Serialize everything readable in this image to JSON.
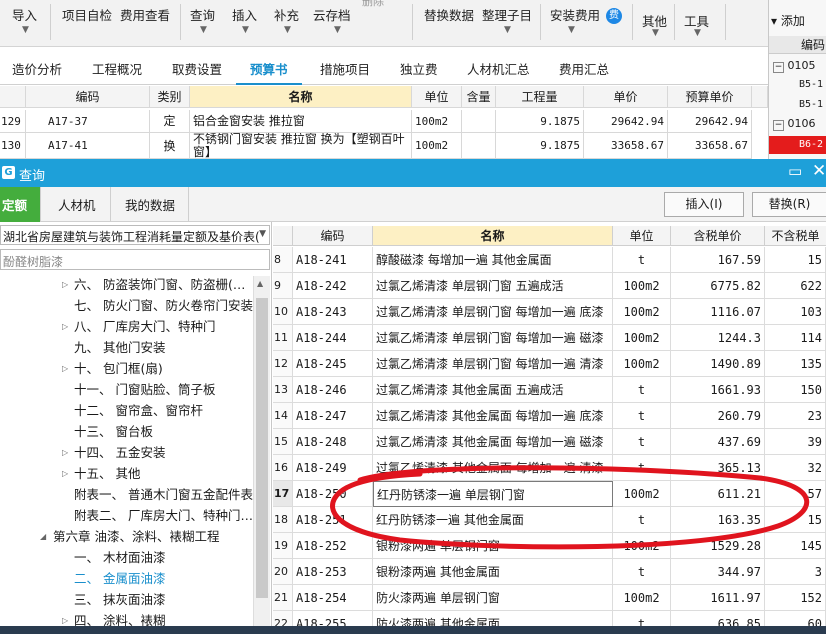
{
  "ribbon": {
    "import": "导入",
    "project_check": "项目自检",
    "fee_view": "费用查看",
    "query": "查询",
    "insert": "插入",
    "supplement": "补充",
    "cloud_save": "云存档",
    "delete": "删除",
    "replace_data": "替换数据",
    "organize_sub": "整理子目",
    "install_fee": "安装费用",
    "fee_badge": "费",
    "other": "其他",
    "tools": "工具"
  },
  "right_panel": {
    "add": "添加",
    "code_header": "编码",
    "rows": [
      "0105",
      "B5-1",
      "B5-1",
      "0106",
      "B6-2"
    ]
  },
  "tabs": [
    "造价分析",
    "工程概况",
    "取费设置",
    "预算书",
    "措施项目",
    "独立费",
    "人材机汇总",
    "费用汇总"
  ],
  "active_tab": "预算书",
  "top_grid": {
    "headers": [
      "编码",
      "类别",
      "名称",
      "单位",
      "含量",
      "工程量",
      "单价",
      "预算单价"
    ],
    "rows": [
      {
        "no": "129",
        "code": "A17-37",
        "type": "定",
        "name": "铝合金窗安装 推拉窗",
        "unit": "100m2",
        "qty": "9.1875",
        "price": "29642.94",
        "budget": "29642.94"
      },
      {
        "no": "130",
        "code": "A17-41",
        "type": "换",
        "name": "不锈钢门窗安装 推拉窗  换为【塑钢百叶窗】",
        "unit": "100m2",
        "qty": "9.1875",
        "price": "33658.67",
        "budget": "33658.67"
      }
    ]
  },
  "dialog": {
    "title": "查询",
    "tabs": [
      "定额",
      "人材机",
      "我的数据"
    ],
    "insert_btn": "插入(I)",
    "replace_btn": "替换(R)",
    "library": "湖北省房屋建筑与装饰工程消耗量定额及基价表(",
    "search_placeholder": "酚醛树脂漆"
  },
  "tree": [
    {
      "label": "六、 防盗装饰门窗、防盗栅(…",
      "arrow": "▷"
    },
    {
      "label": "七、 防火门窗、防火卷帘门安装",
      "arrow": ""
    },
    {
      "label": "八、 厂库房大门、特种门",
      "arrow": "▷"
    },
    {
      "label": "九、 其他门安装",
      "arrow": ""
    },
    {
      "label": "十、 包门框(扇)",
      "arrow": "▷"
    },
    {
      "label": "十一、 门窗贴脸、筒子板",
      "arrow": ""
    },
    {
      "label": "十二、 窗帘盒、窗帘杆",
      "arrow": ""
    },
    {
      "label": "十三、 窗台板",
      "arrow": ""
    },
    {
      "label": "十四、 五金安装",
      "arrow": "▷"
    },
    {
      "label": "十五、 其他",
      "arrow": "▷"
    },
    {
      "label": "附表一、 普通木门窗五金配件表",
      "arrow": ""
    },
    {
      "label": "附表二、 厂库房大门、特种门…",
      "arrow": ""
    },
    {
      "label": "第六章 油漆、涂料、裱糊工程",
      "arrow": "◢"
    },
    {
      "label": "一、 木材面油漆",
      "arrow": ""
    },
    {
      "label": "二、 金属面油漆",
      "arrow": ""
    },
    {
      "label": "三、 抹灰面油漆",
      "arrow": ""
    },
    {
      "label": "四、 涂料、裱糊",
      "arrow": "▷"
    }
  ],
  "tree_selected": 14,
  "grid": {
    "headers": [
      "编码",
      "名称",
      "单位",
      "含税单价",
      "不含税单"
    ],
    "rows": [
      {
        "no": "8",
        "code": "A18-241",
        "name": "醇酸磁漆 每增加一遍 其他金属面",
        "unit": "t",
        "tax_price": "167.59",
        "notax": "15"
      },
      {
        "no": "9",
        "code": "A18-242",
        "name": "过氯乙烯清漆 单层钢门窗 五遍成活",
        "unit": "100m2",
        "tax_price": "6775.82",
        "notax": "622"
      },
      {
        "no": "10",
        "code": "A18-243",
        "name": "过氯乙烯清漆 单层钢门窗 每增加一遍 底漆",
        "unit": "100m2",
        "tax_price": "1116.07",
        "notax": "103"
      },
      {
        "no": "11",
        "code": "A18-244",
        "name": "过氯乙烯清漆 单层钢门窗 每增加一遍 磁漆",
        "unit": "100m2",
        "tax_price": "1244.3",
        "notax": "114"
      },
      {
        "no": "12",
        "code": "A18-245",
        "name": "过氯乙烯清漆 单层钢门窗 每增加一遍 清漆",
        "unit": "100m2",
        "tax_price": "1490.89",
        "notax": "135"
      },
      {
        "no": "13",
        "code": "A18-246",
        "name": "过氯乙烯清漆 其他金属面 五遍成活",
        "unit": "t",
        "tax_price": "1661.93",
        "notax": "150"
      },
      {
        "no": "14",
        "code": "A18-247",
        "name": "过氯乙烯清漆 其他金属面 每增加一遍 底漆",
        "unit": "t",
        "tax_price": "260.79",
        "notax": "23"
      },
      {
        "no": "15",
        "code": "A18-248",
        "name": "过氯乙烯清漆 其他金属面 每增加一遍 磁漆",
        "unit": "t",
        "tax_price": "437.69",
        "notax": "39"
      },
      {
        "no": "16",
        "code": "A18-249",
        "name": "过氯乙烯清漆 其他金属面 每增加一遍 清漆",
        "unit": "t",
        "tax_price": "365.13",
        "notax": "32"
      },
      {
        "no": "17",
        "code": "A18-250",
        "name": "红丹防锈漆一遍 单层钢门窗",
        "unit": "100m2",
        "tax_price": "611.21",
        "notax": "57"
      },
      {
        "no": "18",
        "code": "A18-251",
        "name": "红丹防锈漆一遍 其他金属面",
        "unit": "t",
        "tax_price": "163.35",
        "notax": "15"
      },
      {
        "no": "19",
        "code": "A18-252",
        "name": "银粉漆两遍 单层钢门窗",
        "unit": "100m2",
        "tax_price": "1529.28",
        "notax": "145"
      },
      {
        "no": "20",
        "code": "A18-253",
        "name": "银粉漆两遍 其他金属面",
        "unit": "t",
        "tax_price": "344.97",
        "notax": "3"
      },
      {
        "no": "21",
        "code": "A18-254",
        "name": "防火漆两遍 单层钢门窗",
        "unit": "100m2",
        "tax_price": "1611.97",
        "notax": "152"
      },
      {
        "no": "22",
        "code": "A18-255",
        "name": "防火漆两遍 其他金属面",
        "unit": "t",
        "tax_price": "636.85",
        "notax": "60"
      }
    ]
  },
  "selected_row_no": "17",
  "colors": {
    "accent": "#1ea0d9",
    "annotation": "#e0141e",
    "active_tab": "#1a8fcc",
    "highlight_cell": "#e41c1c"
  }
}
